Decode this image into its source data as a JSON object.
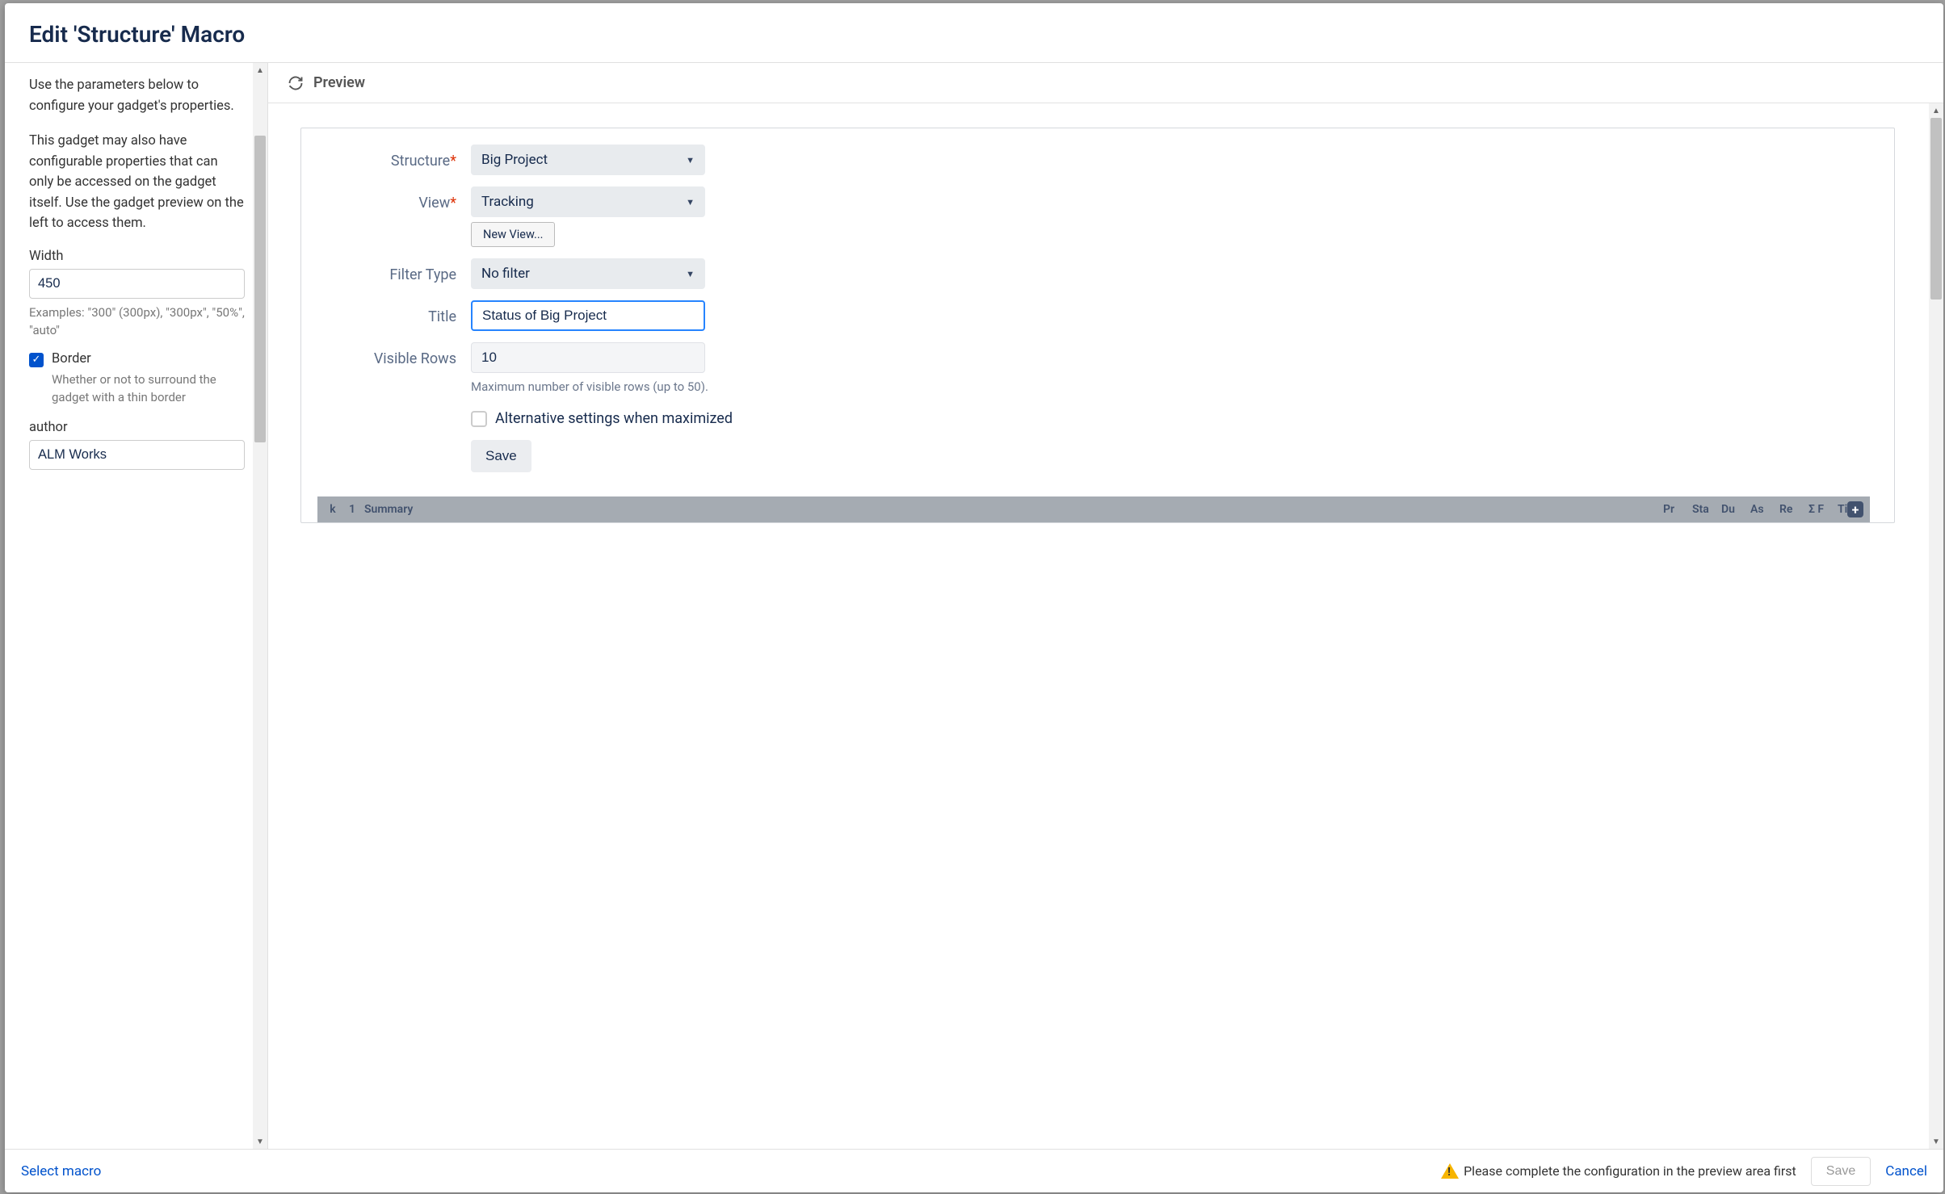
{
  "modal": {
    "title": "Edit 'Structure' Macro"
  },
  "left": {
    "text1": "Use the parameters below to configure your gadget's properties.",
    "text2": "This gadget may also have configurable properties that can only be accessed on the gadget itself. Use the gadget preview on the left to access them.",
    "width_label": "Width",
    "width_value": "450",
    "width_help": "Examples: \"300\" (300px), \"300px\", \"50%\", \"auto\"",
    "border_label": "Border",
    "border_desc": "Whether or not to surround the gadget with a thin border",
    "author_label": "author",
    "author_value": "ALM Works"
  },
  "preview": {
    "header": "Preview",
    "structure_label": "Structure",
    "structure_value": "Big Project",
    "view_label": "View",
    "view_value": "Tracking",
    "new_view": "New View...",
    "filter_label": "Filter Type",
    "filter_value": "No filter",
    "title_label": "Title",
    "title_value": "Status of Big Project",
    "rows_label": "Visible Rows",
    "rows_value": "10",
    "rows_hint": "Maximum number of visible rows (up to 50).",
    "alt_label": "Alternative settings when maximized",
    "save": "Save",
    "columns": {
      "k": "k",
      "n": "1",
      "summary": "Summary",
      "pr": "Pr",
      "st": "Sta",
      "du": "Du",
      "as": "As",
      "re": "Re",
      "sf": "Σ F",
      "tir": "Tir"
    }
  },
  "footer": {
    "select_macro": "Select macro",
    "warning": "Please complete the configuration in the preview area first",
    "save": "Save",
    "cancel": "Cancel"
  }
}
